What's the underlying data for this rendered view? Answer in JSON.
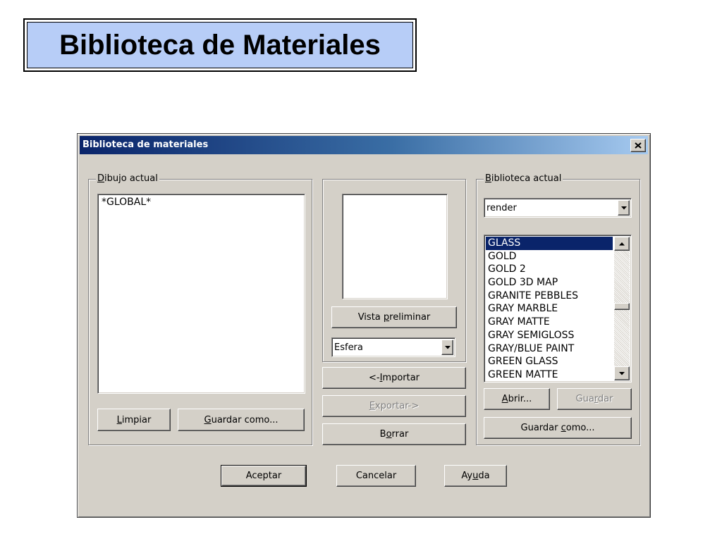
{
  "slide": {
    "title": "Biblioteca de Materiales"
  },
  "dialog": {
    "title": "Biblioteca de materiales",
    "close_glyph": "X",
    "drawing_group": {
      "label_first": "D",
      "label_rest": "ibujo actual",
      "items": [
        "*GLOBAL*"
      ],
      "clear_first": "L",
      "clear_rest": "impiar",
      "saveas_first": "G",
      "saveas_rest": "uardar como..."
    },
    "preview": {
      "button_pre": "Vista ",
      "button_under": "p",
      "button_post": "reliminar",
      "shape_value": "Esfera"
    },
    "middle_buttons": {
      "import_pre": "<-",
      "import_under": "I",
      "import_post": "mportar",
      "export_under": "E",
      "export_post": "xportar->",
      "delete_pre": "B",
      "delete_under": "o",
      "delete_post": "rrar"
    },
    "library_group": {
      "label_first": "B",
      "label_rest": "iblioteca actual",
      "library_value": "render",
      "items": [
        "GLASS",
        "GOLD",
        "GOLD 2",
        "GOLD 3D MAP",
        "GRANITE PEBBLES",
        "GRAY MARBLE",
        "GRAY MATTE",
        "GRAY SEMIGLOSS",
        "GRAY/BLUE PAINT",
        "GREEN GLASS",
        "GREEN MATTE"
      ],
      "selected_index": 0,
      "open_first": "A",
      "open_rest": "brir...",
      "save_pre": "Gua",
      "save_under": "r",
      "save_post": "dar",
      "saveas_pre": "Guardar ",
      "saveas_under": "c",
      "saveas_post": "omo..."
    },
    "bottom_buttons": {
      "ok": "Aceptar",
      "cancel": "Cancelar",
      "help_pre": "Ay",
      "help_under": "u",
      "help_post": "da"
    }
  },
  "icons": {
    "close": "close-icon",
    "dropdown": "chevron-down-icon",
    "scroll_up": "scroll-up-arrow-icon",
    "scroll_down": "scroll-down-arrow-icon"
  }
}
